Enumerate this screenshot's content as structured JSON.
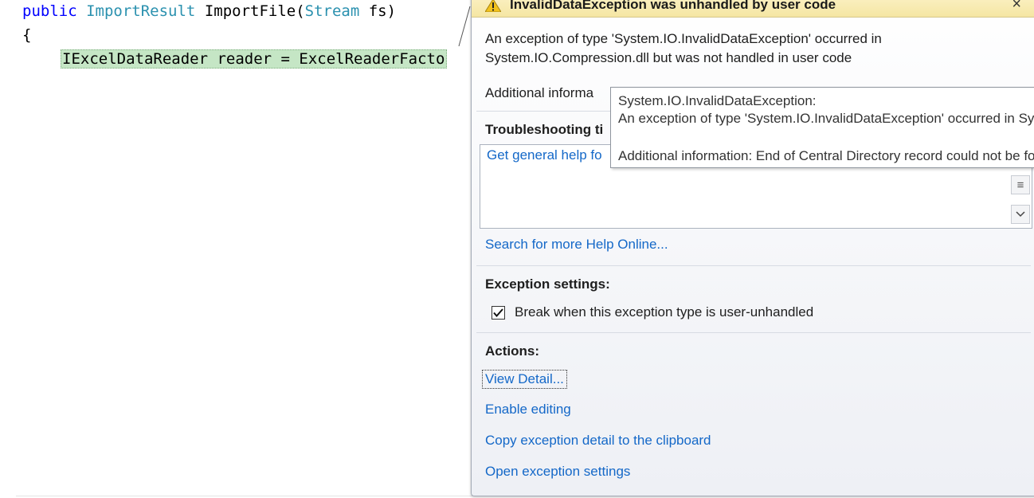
{
  "editor": {
    "line1": {
      "kw_public": "public",
      "type_result": "ImportResult",
      "method": " ImportFile(",
      "type_stream": "Stream",
      "param": " fs)"
    },
    "line2": "{",
    "line3": "IExcelDataReader reader = ExcelReaderFacto"
  },
  "assistant": {
    "title": "InvalidDataException was unhandled by user code",
    "close": "×",
    "message_line1": "An exception of type 'System.IO.InvalidDataException' occurred in",
    "message_line2": "System.IO.Compression.dll but was not handled in user code",
    "additional_info": "Additional informa",
    "troubleshooting_title": "Troubleshooting ti",
    "tips_link": "Get general help fo",
    "search_link": "Search for more Help Online...",
    "exception_settings_title": "Exception settings:",
    "break_checkbox_label": "Break when this exception type is user-unhandled",
    "break_checked": true,
    "actions_title": "Actions:",
    "actions": [
      "View Detail...",
      "Enable editing",
      "Copy exception detail to the clipboard",
      "Open exception settings"
    ]
  },
  "tooltip": {
    "line1": "System.IO.InvalidDataException:",
    "line2": "An exception of type 'System.IO.InvalidDataException' occurred in System.IO.Compression.dll",
    "line3": "Additional information: End of Central Directory record could not be found."
  },
  "colors": {
    "keyword": "#0000ff",
    "type": "#2b91af",
    "link": "#1468c8",
    "highlight": "#c5e6c5",
    "titlebar": "#f5e6a3"
  },
  "icons": {
    "warning": "warning-icon",
    "close": "close-icon",
    "check": "check-icon",
    "scroll_down": "chevron-down-icon",
    "scroll_thumb": "scroll-grip-icon"
  }
}
